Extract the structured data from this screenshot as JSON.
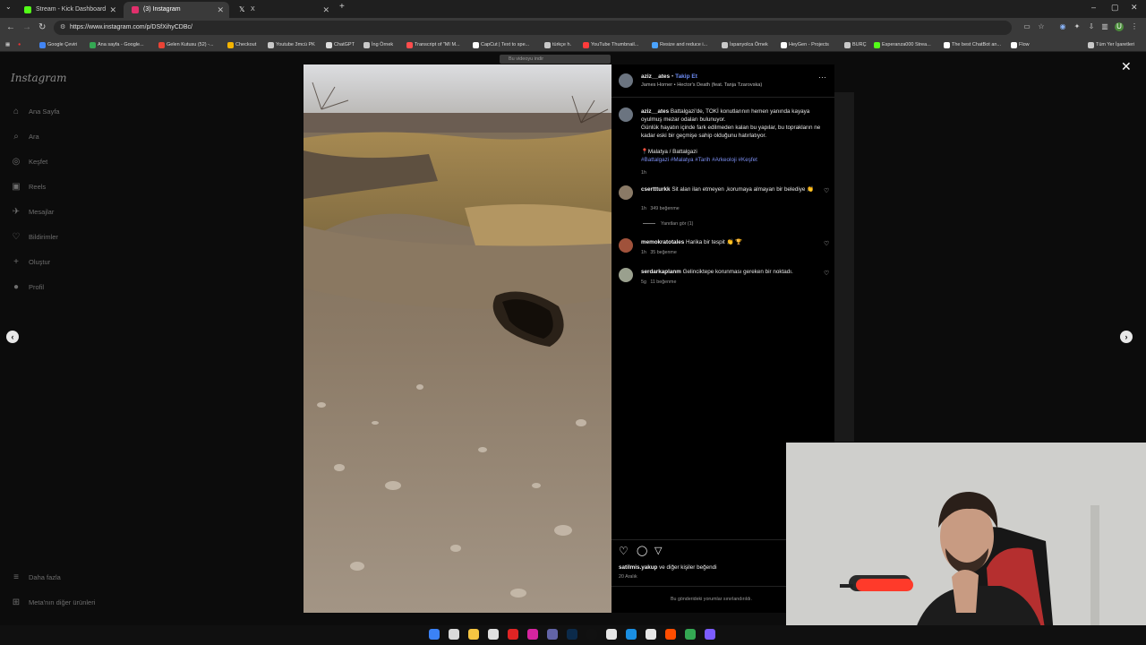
{
  "browser": {
    "tabs": [
      {
        "label": "Stream - Kick Dashboard",
        "icon": "kick-icon",
        "color": "#53fc18"
      },
      {
        "label": "(3) Instagram",
        "icon": "instagram-icon",
        "color": "#e1306c"
      },
      {
        "label": "X",
        "icon": "x-icon",
        "color": "#ffffff"
      }
    ],
    "url": "https://www.instagram.com/p/DSfXihyCDBc/",
    "bookmarks": [
      {
        "label": "Google Çeviri",
        "color": "#4285f4"
      },
      {
        "label": "Ana sayfa - Google...",
        "color": "#34a853"
      },
      {
        "label": "Gelen Kutusu (52) -...",
        "color": "#ea4335"
      },
      {
        "label": "Checkout",
        "color": "#f4b400"
      },
      {
        "label": "Youtube 3mcü PK",
        "color": "#c9c9c9"
      },
      {
        "label": "ChatGPT",
        "color": "#dddddd"
      },
      {
        "label": "İng Örnek",
        "color": "#c9c9c9"
      },
      {
        "label": "Transcript of \"MI M...",
        "color": "#ff4d4d"
      },
      {
        "label": "CapCut | Text to spe...",
        "color": "#ffffff"
      },
      {
        "label": "türkçe h.",
        "color": "#c9c9c9"
      },
      {
        "label": "YouTube Thumbnail...",
        "color": "#ff3b3b"
      },
      {
        "label": "Resize and reduce i...",
        "color": "#4aa3ff"
      },
      {
        "label": "İspanyolca Örnek",
        "color": "#c9c9c9"
      },
      {
        "label": "HeyGen - Projects",
        "color": "#ffffff"
      },
      {
        "label": "BURÇ",
        "color": "#c9c9c9"
      },
      {
        "label": "Esperanza000 Strea...",
        "color": "#53fc18"
      },
      {
        "label": "The best ChatBot an...",
        "color": "#ffffff"
      },
      {
        "label": "Flow",
        "color": "#ffffff"
      },
      {
        "label": "Tüm Yer İşaretleri",
        "color": "#c9c9c9"
      }
    ]
  },
  "instagram": {
    "logo": "Instagram",
    "nav": [
      {
        "label": "Ana Sayfa",
        "icon": "home-icon",
        "glyph": "⌂"
      },
      {
        "label": "Ara",
        "icon": "search-icon",
        "glyph": "⌕"
      },
      {
        "label": "Keşfet",
        "icon": "compass-icon",
        "glyph": "◎"
      },
      {
        "label": "Reels",
        "icon": "reels-icon",
        "glyph": "▣"
      },
      {
        "label": "Mesajlar",
        "icon": "messenger-icon",
        "glyph": "✈"
      },
      {
        "label": "Bildirimler",
        "icon": "heart-icon",
        "glyph": "♡"
      },
      {
        "label": "Oluştur",
        "icon": "plus-icon",
        "glyph": "+"
      },
      {
        "label": "Profil",
        "icon": "profile-avatar-icon",
        "glyph": "●"
      }
    ],
    "more": {
      "label": "Daha fazla",
      "glyph": "≡"
    },
    "meta": {
      "label": "Meta'nın diğer ürünleri",
      "glyph": "⊞"
    },
    "download_pill": "Bu videoyu indir",
    "post": {
      "author": "aziz__ates",
      "follow": "Takip Et",
      "audio": "James Horner • Hector's Death (feat. Tanja Tzarovska)",
      "caption_lines": [
        "Battalgazi'de, TOKİ konutlarının hemen yanında kayaya oyulmuş mezar odaları bulunuyor.",
        "Günlük hayatın içinde fark edilmeden kalan bu yapılar, bu toprakların ne kadar eski bir geçmişe sahip olduğunu hatırlatıyor."
      ],
      "location": "📍Malatya / Battalgazi",
      "hashtags": "#Battalgazi #Malatya #Tarih #Arkeoloji #Keşfet",
      "caption_time": "1h",
      "comments": [
        {
          "user": "cserttturkk",
          "text": "Sit alan ilan etmeyen ,korumaya almayan bir belediye 👏",
          "time": "1h",
          "likes": "349 beğenme",
          "replies": "Yanıtları gör (1)"
        },
        {
          "user": "memokratotales",
          "text": "Harika bir tespit 👏 🏆",
          "time": "1h",
          "likes": "35 beğenme"
        },
        {
          "user": "serdarkaplanm",
          "text": "Gelinciktepe korunması gereken bir noktadı.",
          "time": "5g",
          "likes": "11 beğenme"
        }
      ],
      "liked_by": "satilmis.yakup",
      "liked_rest": "ve diğer kişiler",
      "liked_suffix": "beğendi",
      "date": "20 Aralık",
      "comments_limited": "Bu gönderideki yorumlar sınırlandırıldı."
    }
  },
  "taskbar": {
    "icons": [
      {
        "name": "windows-start-icon",
        "color": "#3b82f6"
      },
      {
        "name": "file-explorer-icon",
        "color": "#d9d9d9"
      },
      {
        "name": "folder-icon",
        "color": "#f5c542"
      },
      {
        "name": "chrome-icon",
        "color": "#e0e0e0"
      },
      {
        "name": "opera-icon",
        "color": "#e02424"
      },
      {
        "name": "instagram-icon",
        "color": "#d6249f"
      },
      {
        "name": "teams-icon",
        "color": "#6264a7"
      },
      {
        "name": "photoshop-icon",
        "color": "#0b2a4a"
      },
      {
        "name": "tiktok-icon",
        "color": "#111111"
      },
      {
        "name": "capcut-icon",
        "color": "#e6e6e6"
      },
      {
        "name": "edge-icon",
        "color": "#1a8fe3"
      },
      {
        "name": "obs-icon",
        "color": "#e6e6e6"
      },
      {
        "name": "adobe-icon",
        "color": "#ff4d00"
      },
      {
        "name": "chrome-icon-2",
        "color": "#34a853"
      },
      {
        "name": "app-icon",
        "color": "#7c5cff"
      }
    ]
  }
}
